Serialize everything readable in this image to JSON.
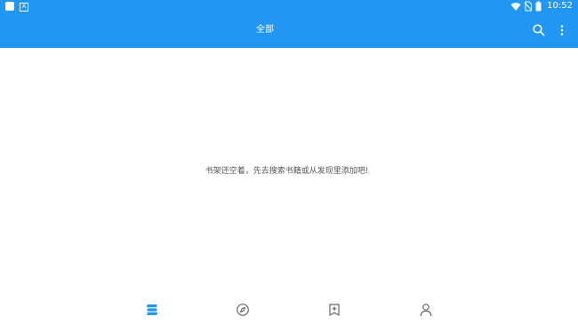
{
  "status_bar": {
    "time": "10:52",
    "notification_letter": "A",
    "icons": [
      "app-icon",
      "a-notification-icon",
      "wifi-icon",
      "no-sim-icon",
      "battery-icon"
    ]
  },
  "toolbar": {
    "title": "全部",
    "actions": [
      "search-icon",
      "more-vert-icon"
    ]
  },
  "main": {
    "empty_message": "书架还空着，先去搜索书籍或从发现里添加吧!"
  },
  "bottom_nav": {
    "items": [
      {
        "icon": "bookshelf-icon",
        "selected": true
      },
      {
        "icon": "compass-icon",
        "selected": false
      },
      {
        "icon": "bookmark-add-icon",
        "selected": false
      },
      {
        "icon": "person-icon",
        "selected": false
      }
    ]
  },
  "colors": {
    "accent": "#2196f3",
    "background": "#ffffff",
    "text_secondary": "#555555",
    "icon_inactive": "#666666"
  }
}
